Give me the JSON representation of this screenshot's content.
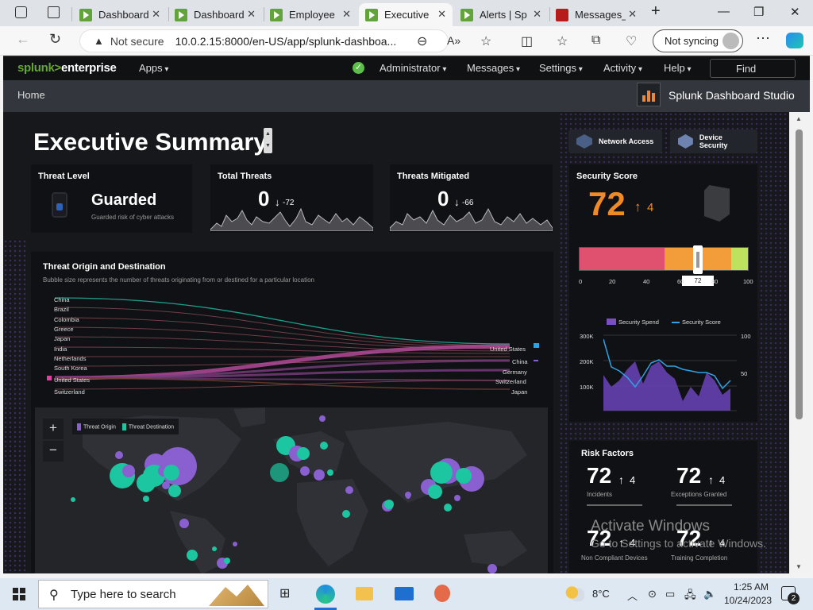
{
  "browser": {
    "tabs": [
      {
        "label": "Dashboard",
        "icon": "splunk-icon",
        "active": false
      },
      {
        "label": "Dashboard",
        "icon": "splunk-icon",
        "active": false
      },
      {
        "label": "Employee",
        "icon": "splunk-icon",
        "active": false
      },
      {
        "label": "Executive",
        "icon": "splunk-icon",
        "active": true
      },
      {
        "label": "Alerts | Sp",
        "icon": "splunk-icon",
        "active": false
      },
      {
        "label": "Messages_",
        "icon": "pdf-icon",
        "active": false
      }
    ],
    "security_label": "Not secure",
    "url": "10.0.2.15:8000/en-US/app/splunk-dashboa...",
    "sync_label": "Not syncing"
  },
  "splunk": {
    "logo_a": "splunk>",
    "logo_b": "enterprise",
    "nav": {
      "apps": "Apps",
      "admin": "Administrator",
      "messages": "Messages",
      "settings": "Settings",
      "activity": "Activity",
      "help": "Help"
    },
    "find": "Find",
    "breadcrumb": "Home",
    "studio": "Splunk Dashboard Studio"
  },
  "dashboard": {
    "title": "Executive Summary",
    "buttons": {
      "network": "Network Access",
      "device": "Device Security"
    },
    "threat_level": {
      "title": "Threat Level",
      "value": "Guarded",
      "sub": "Guarded risk of cyber attacks"
    },
    "total_threats": {
      "title": "Total Threats",
      "value": "0",
      "delta": "-72"
    },
    "threats_mitigated": {
      "title": "Threats Mitigated",
      "value": "0",
      "delta": "-66"
    },
    "security_score": {
      "title": "Security Score",
      "value": "72",
      "delta": "4",
      "gauge_value": "72",
      "gauge_ticks": [
        "0",
        "20",
        "40",
        "60",
        "80",
        "100"
      ]
    },
    "origin": {
      "title": "Threat Origin and Destination",
      "subtitle": "Bubble size represents the number of threats originating from or destined for a particular location",
      "sources": [
        "China",
        "Brazil",
        "Colombia",
        "Greece",
        "Japan",
        "India",
        "Netherlands",
        "South Korea",
        "United States",
        "Switzerland"
      ],
      "targets": [
        "United States",
        "China",
        "Germany",
        "Switzerland",
        "Japan"
      ],
      "legend_origin": "Threat Origin",
      "legend_destination": "Threat Destination",
      "zoom_in": "+",
      "zoom_out": "−"
    },
    "risk": {
      "title": "Risk Factors",
      "items": [
        {
          "value": "72",
          "delta": "4",
          "label": "Incidents"
        },
        {
          "value": "72",
          "delta": "4",
          "label": "Exceptions Granted"
        },
        {
          "value": "72",
          "delta": "4",
          "label": "Non Compliant Devices"
        },
        {
          "value": "72",
          "delta": "4",
          "label": "Training Completion"
        }
      ]
    }
  },
  "chart_data": {
    "type": "area",
    "series": [
      {
        "name": "Security Spend"
      },
      {
        "name": "Security Score"
      }
    ],
    "y_left_ticks": [
      "300K",
      "200K",
      "100K"
    ],
    "y_right_ticks": [
      "100",
      "50"
    ]
  },
  "overlay": {
    "line1": "Activate Windows",
    "line2": "Go to Settings to activate Windows."
  },
  "taskbar": {
    "search": "Type here to search",
    "temp": "8°C",
    "time": "1:25 AM",
    "date": "10/24/2023",
    "notif": "2"
  }
}
